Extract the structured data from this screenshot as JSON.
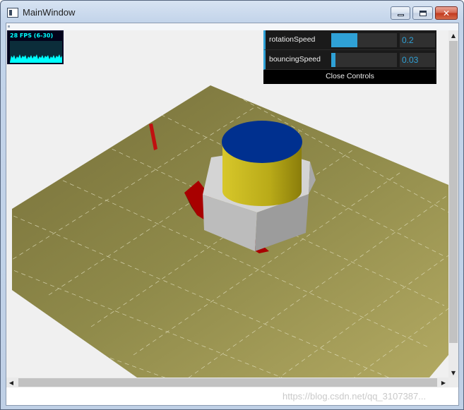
{
  "window": {
    "title": "MainWindow",
    "icon": "app-window-icon",
    "controls": {
      "minimize": "minimize-icon",
      "maximize": "maximize-icon",
      "close": "close-icon"
    }
  },
  "stats": {
    "fps_text": "28 FPS (6-30)",
    "fps": 28,
    "min": 6,
    "max": 30
  },
  "gui": {
    "controllers": [
      {
        "label": "rotationSpeed",
        "value": "0.2",
        "slider_fraction": 0.4
      },
      {
        "label": "bouncingSpeed",
        "value": "0.03",
        "slider_fraction": 0.06
      }
    ],
    "close_label": "Close Controls",
    "accent": "#2fa1d6"
  },
  "scene": {
    "plane_color": "#8f8a4a",
    "cylinder_side_color": "#c6b81e",
    "cylinder_top_color": "#00308f",
    "hexagon_color": "#c4c4c4",
    "cube_color": "#cc0000"
  },
  "scrollbars": {
    "up_glyph": "▲",
    "down_glyph": "▼",
    "left_glyph": "◀",
    "right_glyph": "▶"
  },
  "watermark": "https://blog.csdn.net/qq_3107387..."
}
